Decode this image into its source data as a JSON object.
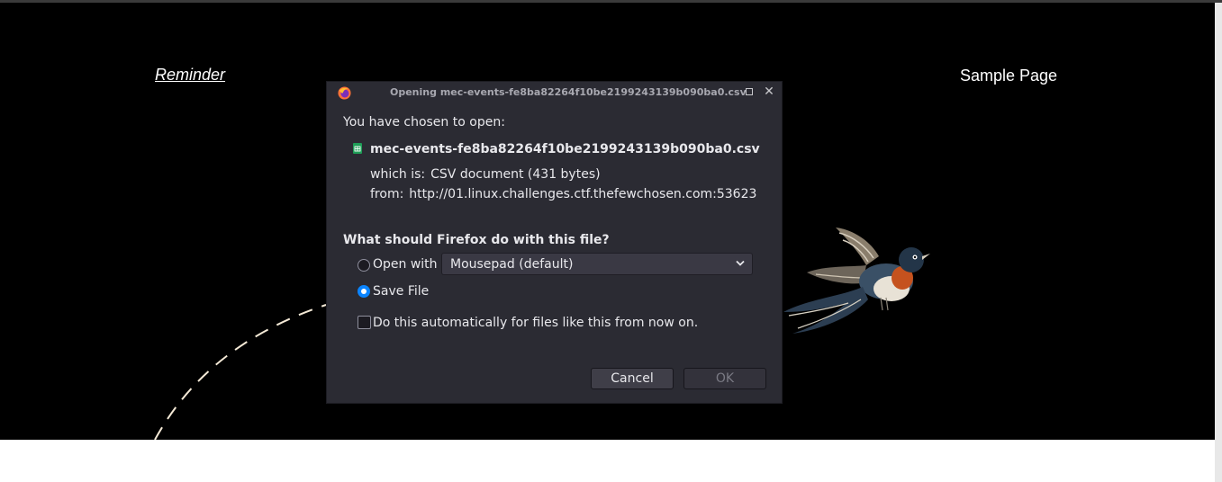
{
  "page": {
    "site_title": "Reminder",
    "nav": [
      "Sample Page"
    ]
  },
  "dialog": {
    "title": "Opening mec-events-fe8ba82264f10be2199243139b090ba0.csv",
    "intro": "You have chosen to open:",
    "file_name": "mec-events-fe8ba82264f10be2199243139b090ba0.csv",
    "type_label": "which is:",
    "type_value": "CSV document (431 bytes)",
    "from_label": "from:",
    "from_value": "http://01.linux.challenges.ctf.thefewchosen.com:53623",
    "question": "What should Firefox do with this file?",
    "open_with_label": "Open with",
    "open_with_selected": false,
    "open_with_app": "Mousepad (default)",
    "save_file_label": "Save File",
    "save_file_selected": true,
    "auto_label": "Do this automatically for files like this from now on.",
    "auto_checked": false,
    "cancel_label": "Cancel",
    "ok_label": "OK",
    "ok_enabled": false
  },
  "icons": {
    "app": "firefox-icon",
    "file": "spreadsheet-file-icon",
    "maximize": "maximize-icon",
    "close": "close-icon",
    "dropdown": "chevron-down-icon"
  },
  "colors": {
    "dialog_bg": "#2b2b33",
    "accent": "#0a84ff",
    "header_bg": "#000000"
  }
}
